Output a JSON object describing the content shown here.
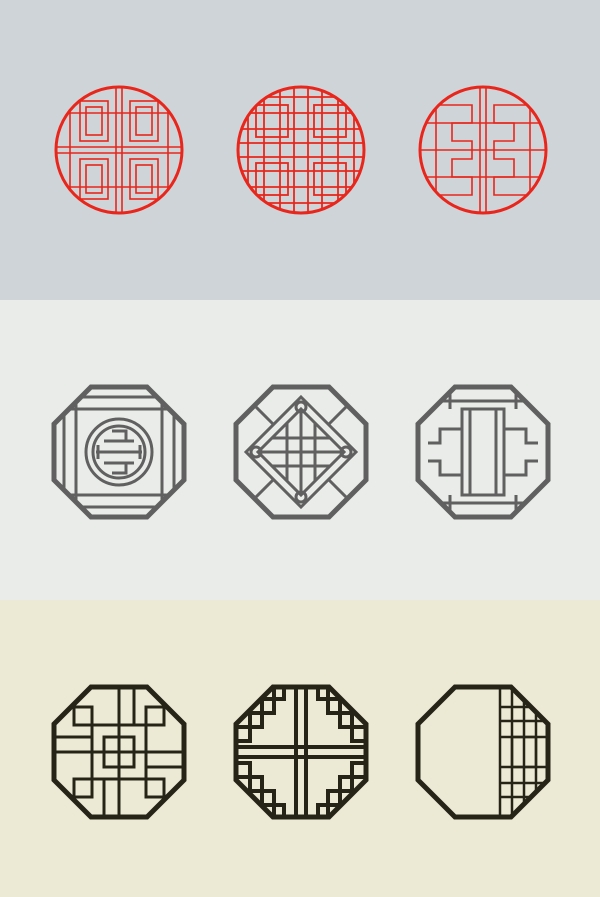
{
  "rows": [
    {
      "background": "#cfd4d9",
      "stroke": "#e8261b",
      "shape": "circle",
      "emblems": [
        "circle-lattice-rectangles-icon",
        "circle-lattice-dense-icon",
        "circle-lattice-meander-icon"
      ]
    },
    {
      "background": "#e9ece8",
      "stroke": "#606060",
      "shape": "octagon",
      "emblems": [
        "octagon-shou-symbol-icon",
        "octagon-diamond-lattice-icon",
        "octagon-pillar-lattice-icon"
      ]
    },
    {
      "background": "#ecead5",
      "stroke": "#262417",
      "shape": "octagon",
      "emblems": [
        "octagon-fret-lattice-icon",
        "octagon-cross-stripes-icon",
        "octagon-corner-lattice-icon"
      ]
    }
  ]
}
